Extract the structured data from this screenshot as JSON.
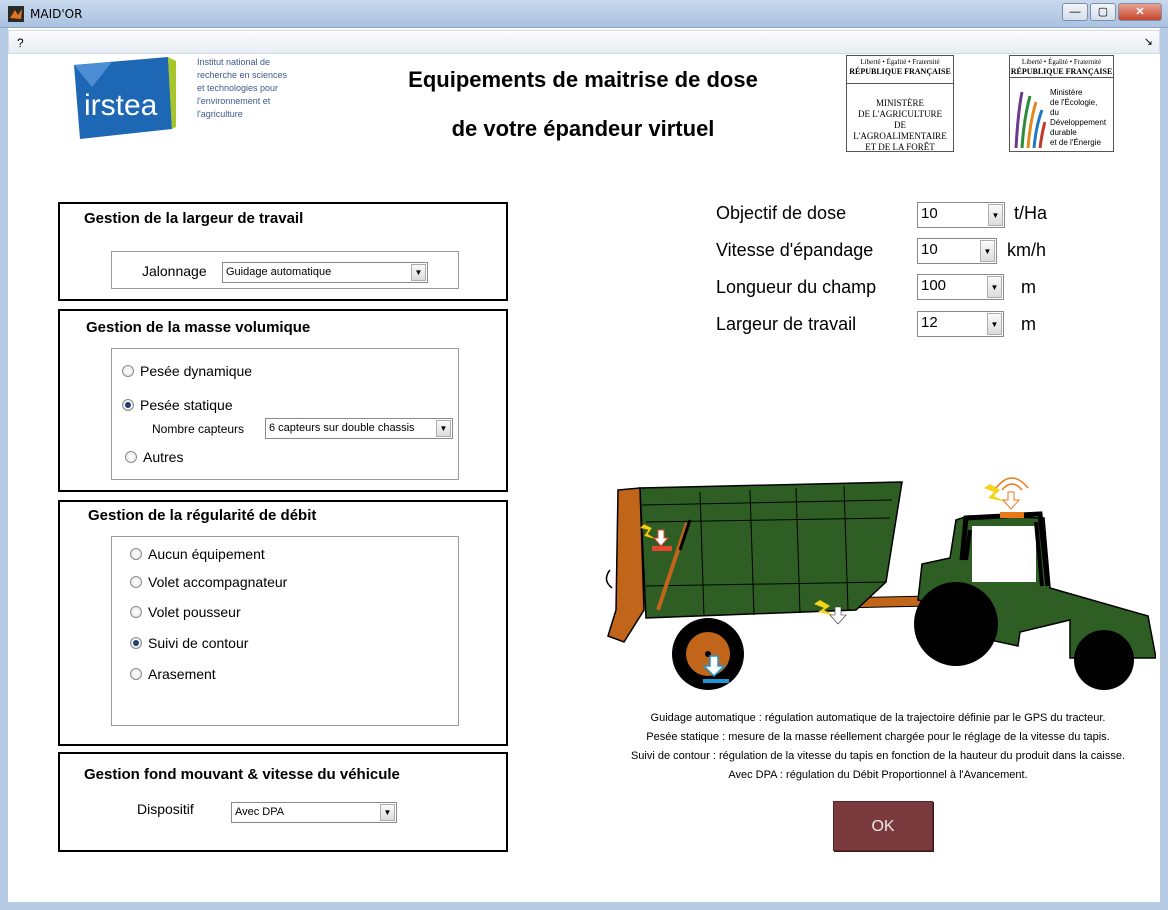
{
  "window": {
    "title": "MAID'OR",
    "minimize": "—",
    "maximize": "▢",
    "close": "✕"
  },
  "menu": {
    "help": "?",
    "arrow": "↘"
  },
  "header": {
    "title_line1": "Equipements de maitrise de dose",
    "title_line2": "de votre épandeur virtuel",
    "irstea_logo_text": "irstea",
    "irstea_tagline": [
      "Institut national de",
      "recherche en sciences",
      "et technologies pour",
      "l'environnement et",
      "l'agriculture"
    ],
    "ministry1": {
      "motto": "Liberté • Égalité • Fraternité",
      "republic": "RÉPUBLIQUE FRANÇAISE",
      "lines": [
        "MINISTÈRE",
        "DE L'AGRICULTURE",
        "DE L'AGROALIMENTAIRE",
        "ET DE LA FORÊT"
      ]
    },
    "ministry2": {
      "motto": "Liberté • Égalité • Fraternité",
      "republic": "RÉPUBLIQUE FRANÇAISE",
      "lines": [
        "Ministère",
        "de l'Écologie,",
        "du Développement",
        "durable",
        "et de l'Énergie"
      ]
    }
  },
  "largeur": {
    "title": "Gestion de la largeur de travail",
    "label": "Jalonnage",
    "value": "Guidage automatique"
  },
  "masse": {
    "title": "Gestion de la masse volumique",
    "options": [
      "Pesée dynamique",
      "Pesée statique",
      "Autres"
    ],
    "selected": 1,
    "capteurs_label": "Nombre capteurs",
    "capteurs_value": "6 capteurs sur double chassis"
  },
  "regularite": {
    "title": "Gestion de la régularité de débit",
    "options": [
      "Aucun équipement",
      "Volet accompagnateur",
      "Volet pousseur",
      "Suivi de contour",
      "Arasement"
    ],
    "selected": 3
  },
  "fond": {
    "title": "Gestion fond mouvant & vitesse du véhicule",
    "label": "Dispositif",
    "value": "Avec DPA"
  },
  "params": [
    {
      "label": "Objectif de dose",
      "value": "10",
      "unit": "t/Ha"
    },
    {
      "label": "Vitesse d'épandage",
      "value": "10",
      "unit": "km/h"
    },
    {
      "label": "Longueur du champ",
      "value": "100",
      "unit": "m"
    },
    {
      "label": "Largeur de travail",
      "value": "12",
      "unit": "m"
    }
  ],
  "legend": [
    "Guidage automatique : régulation automatique de la trajectoire définie par le GPS du tracteur.",
    "Pesée statique : mesure de la masse réellement chargée pour le réglage de la vitesse du tapis.",
    "Suivi de contour : régulation de la vitesse du tapis en fonction de la hauteur du produit dans la caisse.",
    "Avec DPA : régulation du Débit Proportionnel à l'Avancement."
  ],
  "ok_label": "OK",
  "colors": {
    "tractor_green": "#2f5e24",
    "spreader_orange": "#c1651b",
    "ok_button": "#7b3a3d",
    "irstea_blue": "#1d67b5",
    "irstea_green": "#a8c52a"
  }
}
